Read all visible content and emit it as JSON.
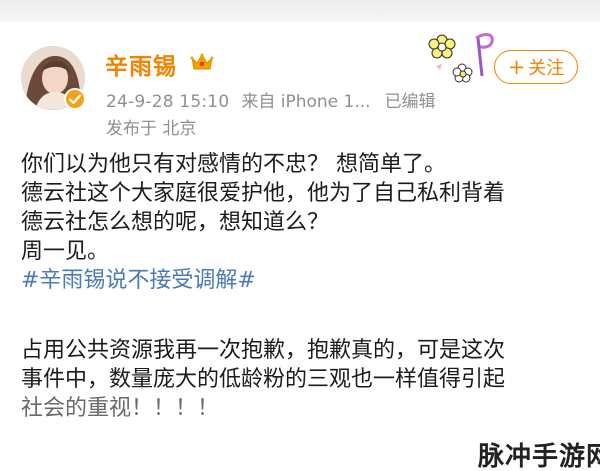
{
  "author": {
    "name": "辛雨锡",
    "timestamp": "24-9-28 15:10",
    "source": "来自 iPhone 1...",
    "edited": "已编辑",
    "location": "发布于 北京",
    "verified_color": "#f4a018"
  },
  "follow_button": {
    "icon": "plus-icon",
    "label": "关注"
  },
  "post": {
    "lines": [
      "你们以为他只有对感情的不忠？ 想简单了。",
      "德云社这个大家庭很爱护他，他为了自己私利背着",
      "德云社怎么想的呢，想知道么？",
      "周一见。"
    ],
    "hashtag": "#辛雨锡说不接受调解#",
    "lines2": [
      "占用公共资源我再一次抱歉，抱歉真的，可是这次",
      "事件中，数量庞大的低龄粉的三观也一样值得引起",
      "社会的重视！！！！"
    ]
  },
  "watermark": "脉冲手游网",
  "colors": {
    "accent": "#f08300",
    "hashtag": "#4a79b8",
    "meta": "#8f8f8f"
  }
}
